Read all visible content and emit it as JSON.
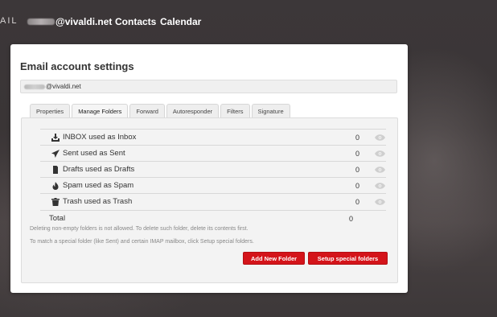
{
  "header": {
    "app_fragment": "AIL",
    "account_suffix": "@vivaldi.net",
    "nav": [
      {
        "label": "Contacts"
      },
      {
        "label": "Calendar"
      }
    ]
  },
  "panel": {
    "title": "Email account settings",
    "account_suffix": "@vivaldi.net",
    "tabs": [
      {
        "label": "Properties",
        "active": false
      },
      {
        "label": "Manage Folders",
        "active": true
      },
      {
        "label": "Forward",
        "active": false
      },
      {
        "label": "Autoresponder",
        "active": false
      },
      {
        "label": "Filters",
        "active": false
      },
      {
        "label": "Signature",
        "active": false
      }
    ],
    "folders": [
      {
        "icon": "inbox-icon",
        "label": "INBOX used as Inbox",
        "count": "0"
      },
      {
        "icon": "send-icon",
        "label": "Sent used as Sent",
        "count": "0"
      },
      {
        "icon": "document-icon",
        "label": "Drafts used as Drafts",
        "count": "0"
      },
      {
        "icon": "fire-icon",
        "label": "Spam used as Spam",
        "count": "0"
      },
      {
        "icon": "trash-icon",
        "label": "Trash used as Trash",
        "count": "0"
      }
    ],
    "total": {
      "label": "Total",
      "count": "0"
    },
    "notes": [
      "Deleting non-empty folders is not allowed. To delete such folder, delete its contents first.",
      "To match a special folder (like Sent) and certain IMAP mailbox, click Setup special folders."
    ],
    "buttons": {
      "add_folder": "Add New Folder",
      "setup_special": "Setup special folders"
    }
  },
  "colors": {
    "accent": "#d4141a",
    "panel_bg": "#ffffff",
    "tab_body_bg": "#f3f3f3"
  }
}
